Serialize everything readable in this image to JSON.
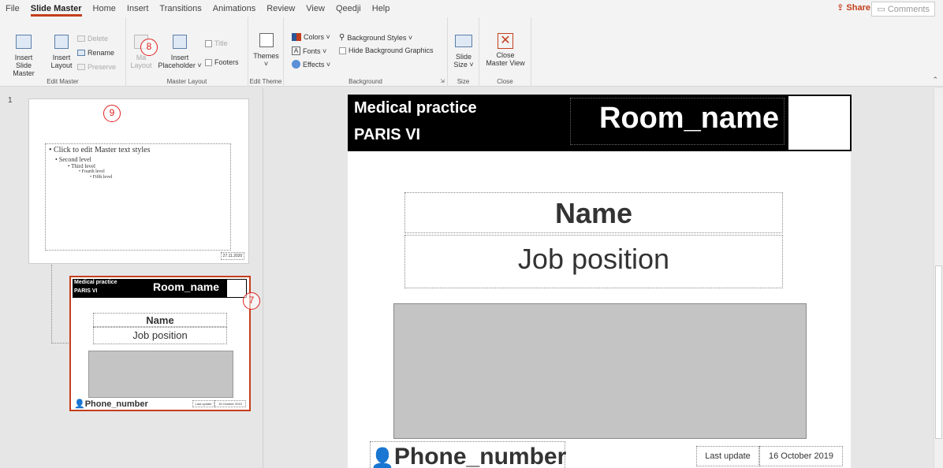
{
  "ribbon": {
    "tabs": [
      "File",
      "Slide Master",
      "Home",
      "Insert",
      "Transitions",
      "Animations",
      "Review",
      "View",
      "Qeedji",
      "Help"
    ],
    "active_tab": "Slide Master",
    "share": "Share",
    "comments": "Comments",
    "edit_master": {
      "label": "Edit Master",
      "insert_slide_master": [
        "Insert Slide",
        "Master"
      ],
      "insert_layout": [
        "Insert",
        "Layout"
      ],
      "delete": "Delete",
      "rename": "Rename",
      "preserve": "Preserve"
    },
    "master_layout": {
      "label": "Master Layout",
      "master_layout_btn": [
        "Ma",
        "Layout"
      ],
      "insert_placeholder": [
        "Insert",
        "Placeholder ˅"
      ],
      "title": "Title",
      "footers": "Footers"
    },
    "edit_theme": {
      "label": "Edit Theme",
      "themes": "Themes",
      "themes_arrow": "˅"
    },
    "background": {
      "label": "Background",
      "colors": "Colors ˅",
      "fonts": "Fonts ˅",
      "effects": "Effects ˅",
      "background_styles": "Background Styles ˅",
      "hide_background_graphics": "Hide Background Graphics"
    },
    "size": {
      "label": "Size",
      "slide_size": [
        "Slide",
        "Size ˅"
      ]
    },
    "close": {
      "label": "Close",
      "close_master_view": [
        "Close",
        "Master View"
      ]
    }
  },
  "annotations": {
    "n7": "7",
    "n8": "8",
    "n9": "9"
  },
  "thumbs": {
    "slide_number": "1",
    "master": {
      "text_styles": "• Click to edit Master text styles",
      "level2": "• Second level",
      "level3": "• Third level",
      "level4": "• Fourth level",
      "level5": "• Fifth level",
      "date": "27.11.2020"
    },
    "layout": {
      "title1": "Medical practice",
      "title2": "PARIS VI",
      "room": "Room_name",
      "name": "Name",
      "job": "Job position",
      "phone": "Phone_number",
      "last_update": "Last update",
      "date": "16 October 2019"
    }
  },
  "slide": {
    "title1": "Medical practice",
    "title2": "PARIS VI",
    "room": "Room_name",
    "name": "Name",
    "job": "Job position",
    "phone": "Phone_number",
    "last_update": "Last update",
    "date": "16 October 2019"
  }
}
